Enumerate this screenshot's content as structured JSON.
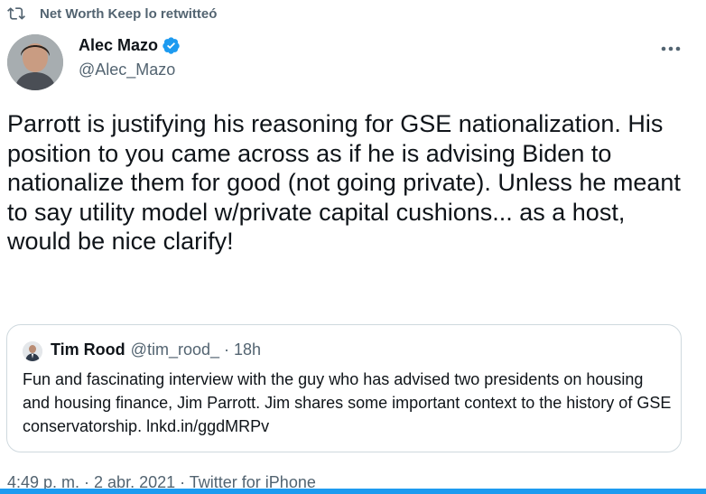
{
  "retweet": {
    "label": "Net Worth Keep lo retwitteó",
    "icon": "retweet-icon"
  },
  "author": {
    "name": "Alec Mazo",
    "handle": "@Alec_Mazo",
    "verified": true,
    "avatar_icon": "person-avatar"
  },
  "tweet": {
    "text": "Parrott is justifying his reasoning for GSE nationalization. His position to you came across as if he is advising Biden to nationalize them for good (not going private). Unless he meant to say utility model w/private capital cushions... as a host, would be nice clarify!"
  },
  "quote": {
    "name": "Tim Rood",
    "handle": "@tim_rood_",
    "separator": "·",
    "time": "18h",
    "text": "Fun and fascinating interview with the guy who has advised two presidents on housing and housing finance, Jim Parrott. Jim shares some important context to the history of GSE conservatorship. ",
    "link": "lnkd.in/ggdMRPv"
  },
  "meta": {
    "text": "4:49 p. m. · 2 abr. 2021 · Twitter for iPhone"
  },
  "colors": {
    "text": "#0f1419",
    "secondary": "#536471",
    "verified": "#1d9bf0",
    "border": "#cfd9de",
    "accent": "#1d9bf0"
  }
}
